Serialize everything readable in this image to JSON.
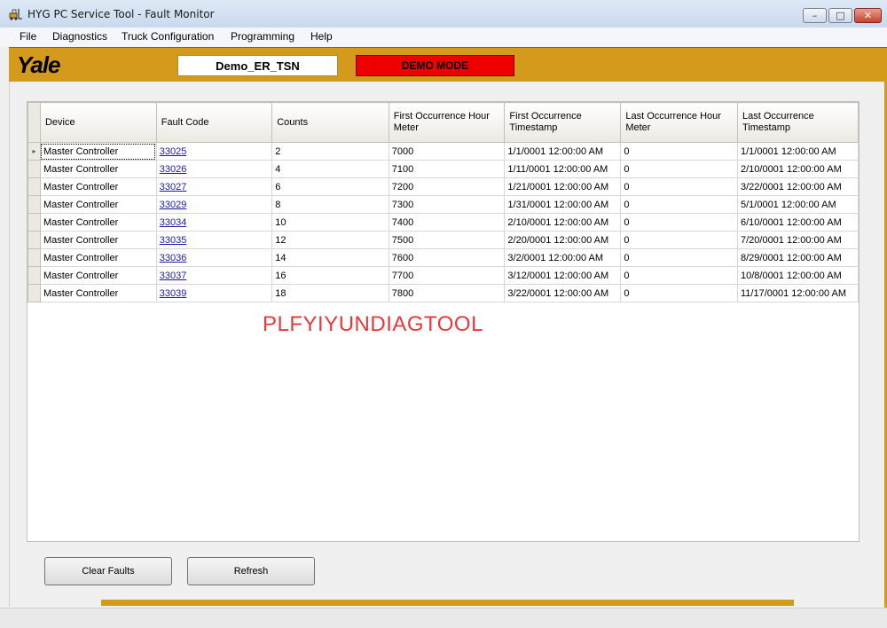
{
  "window": {
    "title": "HYG PC Service Tool - Fault Monitor",
    "controls": {
      "minimize": "–",
      "maximize": "□",
      "close": "✕"
    }
  },
  "menu": [
    "File",
    "Diagnostics",
    "Truck Configuration",
    "Programming",
    "Help"
  ],
  "brand": {
    "logo": "Yale",
    "truck_id": "Demo_ER_TSN",
    "mode": "DEMO MODE",
    "colors": {
      "brand_bar": "#d39a1c",
      "mode_box": "#ee0000"
    }
  },
  "grid": {
    "columns": [
      "Device",
      "Fault Code",
      "Counts",
      "First Occurrence Hour Meter",
      "First Occurrence Timestamp",
      "Last Occurrence Hour Meter",
      "Last Occurrence Timestamp"
    ],
    "current_row_marker": "▸",
    "rows": [
      [
        "Master Controller",
        "33025",
        "2",
        "7000",
        "1/1/0001 12:00:00 AM",
        "0",
        "1/1/0001 12:00:00 AM"
      ],
      [
        "Master Controller",
        "33026",
        "4",
        "7100",
        "1/11/0001 12:00:00 AM",
        "0",
        "2/10/0001 12:00:00 AM"
      ],
      [
        "Master Controller",
        "33027",
        "6",
        "7200",
        "1/21/0001 12:00:00 AM",
        "0",
        "3/22/0001 12:00:00 AM"
      ],
      [
        "Master Controller",
        "33029",
        "8",
        "7300",
        "1/31/0001 12:00:00 AM",
        "0",
        "5/1/0001 12:00:00 AM"
      ],
      [
        "Master Controller",
        "33034",
        "10",
        "7400",
        "2/10/0001 12:00:00 AM",
        "0",
        "6/10/0001 12:00:00 AM"
      ],
      [
        "Master Controller",
        "33035",
        "12",
        "7500",
        "2/20/0001 12:00:00 AM",
        "0",
        "7/20/0001 12:00:00 AM"
      ],
      [
        "Master Controller",
        "33036",
        "14",
        "7600",
        "3/2/0001 12:00:00 AM",
        "0",
        "8/29/0001 12:00:00 AM"
      ],
      [
        "Master Controller",
        "33037",
        "16",
        "7700",
        "3/12/0001 12:00:00 AM",
        "0",
        "10/8/0001 12:00:00 AM"
      ],
      [
        "Master Controller",
        "33039",
        "18",
        "7800",
        "3/22/0001 12:00:00 AM",
        "0",
        "11/17/0001 12:00:00 AM"
      ]
    ]
  },
  "watermark": "PLFYIYUNDIAGTOOL",
  "buttons": {
    "clear": "Clear Faults",
    "refresh": "Refresh"
  }
}
